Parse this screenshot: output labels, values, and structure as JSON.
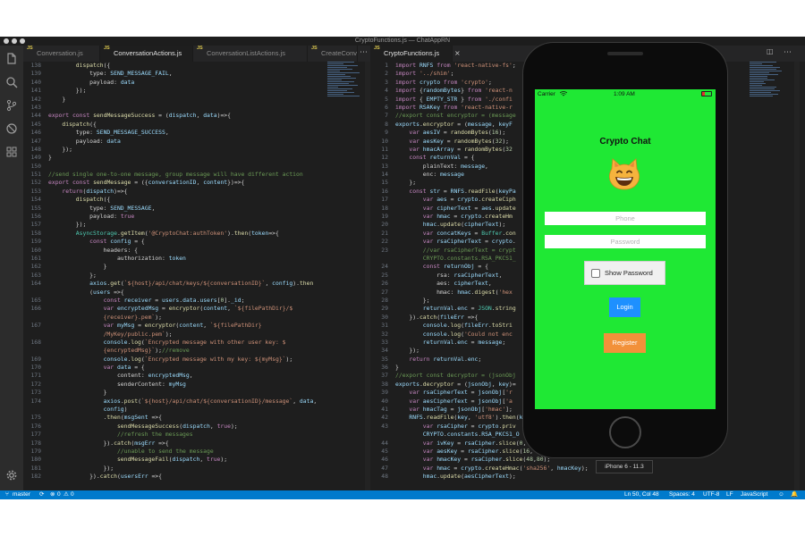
{
  "window": {
    "title": "CryptoFunctions.js — ChatAppRN"
  },
  "activity_icons": [
    "files-icon",
    "search-icon",
    "source-control-icon",
    "debug-icon",
    "extensions-icon",
    "settings-gear-icon"
  ],
  "tabs_left": [
    {
      "label": "Conversation.js"
    },
    {
      "label": "ConversationActions.js"
    },
    {
      "label": "ConversationListActions.js"
    },
    {
      "label": "CreateConv"
    }
  ],
  "tabs_right": [
    {
      "label": "CryptoFunctions.js"
    }
  ],
  "editor_left": {
    "lines": [
      {
        "no": "138",
        "html": "        <span class=\"f\">dispatch</span>({"
      },
      {
        "no": "139",
        "html": "            type: <span class=\"v\">SEND_MESSAGE_FAIL</span>,"
      },
      {
        "no": "140",
        "html": "            payload: <span class=\"v\">data</span>"
      },
      {
        "no": "141",
        "html": "        });"
      },
      {
        "no": "142",
        "html": "    }"
      },
      {
        "no": "143",
        "html": ""
      },
      {
        "no": "144",
        "html": "<span class=\"k\">export</span> <span class=\"k\">const</span> <span class=\"f\">sendMessageSuccess</span> = (<span class=\"v\">dispatch</span>, <span class=\"v\">data</span>)=>{"
      },
      {
        "no": "145",
        "html": "    <span class=\"f\">dispatch</span>({"
      },
      {
        "no": "146",
        "html": "        type: <span class=\"v\">SEND_MESSAGE_SUCCESS</span>,"
      },
      {
        "no": "147",
        "html": "        payload: <span class=\"v\">data</span>"
      },
      {
        "no": "148",
        "html": "    });"
      },
      {
        "no": "149",
        "html": "}"
      },
      {
        "no": "150",
        "html": ""
      },
      {
        "no": "151",
        "html": "<span class=\"c\">//send single one-to-one message, group message will have different action</span>"
      },
      {
        "no": "152",
        "html": "<span class=\"k\">export</span> <span class=\"k\">const</span> <span class=\"f\">sendMessage</span> = ({<span class=\"v\">conversationID</span>, <span class=\"v\">content</span>})=>{"
      },
      {
        "no": "153",
        "html": "    <span class=\"k\">return</span>(<span class=\"v\">dispatch</span>)=>{"
      },
      {
        "no": "154",
        "html": "        <span class=\"f\">dispatch</span>({"
      },
      {
        "no": "155",
        "html": "            type: <span class=\"v\">SEND_MESSAGE</span>,"
      },
      {
        "no": "156",
        "html": "            payload: <span class=\"k\">true</span>"
      },
      {
        "no": "157",
        "html": "        });"
      },
      {
        "no": "158",
        "html": "        <span class=\"t\">AsyncStorage</span>.<span class=\"f\">getItem</span>(<span class=\"s\">'@CryptoChat:authToken'</span>).<span class=\"f\">then</span>(<span class=\"v\">token</span>=>{"
      },
      {
        "no": "159",
        "html": "            <span class=\"k\">const</span> <span class=\"v\">config</span> = {"
      },
      {
        "no": "160",
        "html": "                headers: {"
      },
      {
        "no": "161",
        "html": "                    authorization: <span class=\"v\">token</span>"
      },
      {
        "no": "162",
        "html": "                }"
      },
      {
        "no": "163",
        "html": "            };"
      },
      {
        "no": "164",
        "html": "            <span class=\"v\">axios</span>.<span class=\"f\">get</span>(<span class=\"s\">`${host}/api/chat/keys/${conversationID}`</span>, <span class=\"v\">config</span>).<span class=\"f\">then</span>"
      },
      {
        "no": "",
        "html": "            (<span class=\"v\">users</span> =>{"
      },
      {
        "no": "165",
        "html": "                <span class=\"k\">const</span> <span class=\"v\">receiver</span> = <span class=\"v\">users</span>.<span class=\"v\">data</span>.<span class=\"v\">users</span>[<span class=\"n\">0</span>].<span class=\"v\">_id</span>;"
      },
      {
        "no": "166",
        "html": "                <span class=\"k\">var</span> <span class=\"v\">encryptedMsg</span> = <span class=\"f\">encryptor</span>(<span class=\"v\">content</span>, <span class=\"s\">`${filePathDir}/$</span>"
      },
      {
        "no": "",
        "html": "                <span class=\"s\">{receiver}.pem`</span>);"
      },
      {
        "no": "167",
        "html": "                <span class=\"k\">var</span> <span class=\"v\">myMsg</span> = <span class=\"f\">encryptor</span>(<span class=\"v\">content</span>, <span class=\"s\">`${filePathDir}</span>"
      },
      {
        "no": "",
        "html": "                <span class=\"s\">/MyKey/public.pem`</span>);"
      },
      {
        "no": "168",
        "html": "                <span class=\"v\">console</span>.<span class=\"f\">log</span>(<span class=\"s\">`Encrypted message with other user key: $</span>"
      },
      {
        "no": "",
        "html": "                <span class=\"s\">{encryptedMsg}`</span>);<span class=\"c\">//remove</span>"
      },
      {
        "no": "169",
        "html": "                <span class=\"v\">console</span>.<span class=\"f\">log</span>(<span class=\"s\">`Encrypted message with my key: ${myMsg}`</span>);"
      },
      {
        "no": "170",
        "html": "                <span class=\"k\">var</span> <span class=\"v\">data</span> = {"
      },
      {
        "no": "171",
        "html": "                    content: <span class=\"v\">encryptedMsg</span>,"
      },
      {
        "no": "172",
        "html": "                    senderContent: <span class=\"v\">myMsg</span>"
      },
      {
        "no": "173",
        "html": "                }"
      },
      {
        "no": "174",
        "html": "                <span class=\"v\">axios</span>.<span class=\"f\">post</span>(<span class=\"s\">`${host}/api/chat/${conversationID}/message`</span>, <span class=\"v\">data</span>,"
      },
      {
        "no": "",
        "html": "                <span class=\"v\">config</span>)"
      },
      {
        "no": "175",
        "html": "                .<span class=\"f\">then</span>(<span class=\"v\">msgSent</span> =>{"
      },
      {
        "no": "176",
        "html": "                    <span class=\"f\">sendMessageSuccess</span>(<span class=\"v\">dispatch</span>, <span class=\"k\">true</span>);"
      },
      {
        "no": "177",
        "html": "                    <span class=\"c\">//refresh the messages</span>"
      },
      {
        "no": "178",
        "html": "                }).<span class=\"f\">catch</span>(<span class=\"v\">msgErr</span> =>{"
      },
      {
        "no": "179",
        "html": "                    <span class=\"c\">//unable to send the message</span>"
      },
      {
        "no": "180",
        "html": "                    <span class=\"f\">sendMessageFail</span>(<span class=\"v\">dispatch</span>, <span class=\"k\">true</span>);"
      },
      {
        "no": "181",
        "html": "                });"
      },
      {
        "no": "182",
        "html": "            }).<span class=\"f\">catch</span>(<span class=\"v\">usersErr</span> =>{"
      }
    ]
  },
  "editor_right": {
    "lines": [
      {
        "no": "1",
        "html": "<span class=\"k\">import</span> <span class=\"v\">RNFS</span> <span class=\"k\">from</span> <span class=\"s\">'react-native-fs'</span>;"
      },
      {
        "no": "2",
        "html": "<span class=\"k\">import</span> <span class=\"s\">'../shim'</span>;"
      },
      {
        "no": "3",
        "html": "<span class=\"k\">import</span> <span class=\"v\">crypto</span> <span class=\"k\">from</span> <span class=\"s\">'crypto'</span>;"
      },
      {
        "no": "4",
        "html": "<span class=\"k\">import</span> {<span class=\"v\">randomBytes</span>} <span class=\"k\">from</span> <span class=\"s\">'react-n</span>"
      },
      {
        "no": "5",
        "html": "<span class=\"k\">import</span> { <span class=\"v\">EMPTY_STR</span> } <span class=\"k\">from</span> <span class=\"s\">'./confi</span>"
      },
      {
        "no": "6",
        "html": "<span class=\"k\">import</span> <span class=\"v\">RSAKey</span> <span class=\"k\">from</span> <span class=\"s\">'react-native-r</span>"
      },
      {
        "no": "7",
        "html": "<span class=\"c\">//export const encryptor = (message</span>"
      },
      {
        "no": "8",
        "html": "<span class=\"v\">exports</span>.<span class=\"f\">encryptor</span> = (<span class=\"v\">message</span>, <span class=\"v\">keyF</span>"
      },
      {
        "no": "9",
        "html": "    <span class=\"k\">var</span> <span class=\"v\">aesIV</span> = <span class=\"f\">randomBytes</span>(<span class=\"n\">16</span>);"
      },
      {
        "no": "10",
        "html": "    <span class=\"k\">var</span> <span class=\"v\">aesKey</span> = <span class=\"f\">randomBytes</span>(<span class=\"n\">32</span>);"
      },
      {
        "no": "11",
        "html": "    <span class=\"k\">var</span> <span class=\"v\">hmacArray</span> = <span class=\"f\">randomBytes</span>(<span class=\"n\">32</span>"
      },
      {
        "no": "12",
        "html": "    <span class=\"k\">const</span> <span class=\"v\">returnVal</span> = {"
      },
      {
        "no": "13",
        "html": "        plainText: <span class=\"v\">message</span>,"
      },
      {
        "no": "14",
        "html": "        enc: <span class=\"v\">message</span>"
      },
      {
        "no": "15",
        "html": "    };"
      },
      {
        "no": "16",
        "html": "    <span class=\"k\">const</span> <span class=\"v\">str</span> = <span class=\"v\">RNFS</span>.<span class=\"f\">readFile</span>(<span class=\"v\">keyPa</span>"
      },
      {
        "no": "17",
        "html": "        <span class=\"k\">var</span> <span class=\"v\">aes</span> = <span class=\"v\">crypto</span>.<span class=\"f\">createCiph</span>"
      },
      {
        "no": "18",
        "html": "        <span class=\"k\">var</span> <span class=\"v\">cipherText</span> = <span class=\"v\">aes</span>.<span class=\"f\">update</span>"
      },
      {
        "no": "19",
        "html": "        <span class=\"k\">var</span> <span class=\"v\">hmac</span> = <span class=\"v\">crypto</span>.<span class=\"f\">createHm</span>"
      },
      {
        "no": "20",
        "html": "        <span class=\"v\">hmac</span>.<span class=\"f\">update</span>(<span class=\"v\">cipherText</span>);"
      },
      {
        "no": "21",
        "html": "        <span class=\"k\">var</span> <span class=\"v\">concatKeys</span> = <span class=\"t\">Buffer</span>.<span class=\"f\">con</span>"
      },
      {
        "no": "22",
        "html": "        <span class=\"k\">var</span> <span class=\"v\">rsaCipherText</span> = <span class=\"v\">crypto</span>."
      },
      {
        "no": "23",
        "html": "        <span class=\"c\">//var rsaCipherText = crypt</span>"
      },
      {
        "no": "",
        "html": "        <span class=\"c\">CRYPTO.constants.RSA_PKCS1_</span>"
      },
      {
        "no": "24",
        "html": "        <span class=\"k\">const</span> <span class=\"v\">returnObj</span> = {"
      },
      {
        "no": "25",
        "html": "            rsa: <span class=\"v\">rsaCipherText</span>,"
      },
      {
        "no": "26",
        "html": "            aes: <span class=\"v\">cipherText</span>,"
      },
      {
        "no": "27",
        "html": "            hmac: <span class=\"v\">hmac</span>.<span class=\"f\">digest</span>(<span class=\"s\">'hex</span>"
      },
      {
        "no": "28",
        "html": "        };"
      },
      {
        "no": "29",
        "html": "        <span class=\"v\">returnVal</span>.<span class=\"v\">enc</span> = <span class=\"t\">JSON</span>.<span class=\"f\">string</span>"
      },
      {
        "no": "30",
        "html": "    }).<span class=\"f\">catch</span>(<span class=\"v\">fileErr</span> =>{"
      },
      {
        "no": "31",
        "html": "        <span class=\"v\">console</span>.<span class=\"f\">log</span>(<span class=\"v\">fileErr</span>.<span class=\"f\">toStri</span>"
      },
      {
        "no": "32",
        "html": "        <span class=\"v\">console</span>.<span class=\"f\">log</span>(<span class=\"s\">'Could not enc</span>"
      },
      {
        "no": "33",
        "html": "        <span class=\"v\">returnVal</span>.<span class=\"v\">enc</span> = <span class=\"v\">message</span>;"
      },
      {
        "no": "34",
        "html": "    });"
      },
      {
        "no": "35",
        "html": "    <span class=\"k\">return</span> <span class=\"v\">returnVal</span>.<span class=\"v\">enc</span>;"
      },
      {
        "no": "36",
        "html": "}"
      },
      {
        "no": "37",
        "html": "<span class=\"c\">//export const decryptor = (jsonObj</span>"
      },
      {
        "no": "38",
        "html": "<span class=\"v\">exports</span>.<span class=\"f\">decryptor</span> = (<span class=\"v\">jsonObj</span>, <span class=\"v\">key</span>)="
      },
      {
        "no": "39",
        "html": "    <span class=\"k\">var</span> <span class=\"v\">rsaCipherText</span> = <span class=\"v\">jsonObj</span>[<span class=\"s\">'r</span>"
      },
      {
        "no": "40",
        "html": "    <span class=\"k\">var</span> <span class=\"v\">aesCipherText</span> = <span class=\"v\">jsonObj</span>[<span class=\"s\">'a</span>"
      },
      {
        "no": "41",
        "html": "    <span class=\"k\">var</span> <span class=\"v\">hmacTag</span> = <span class=\"v\">jsonObj</span>[<span class=\"s\">'hmac'</span>];"
      },
      {
        "no": "42",
        "html": "    <span class=\"v\">RNFS</span>.<span class=\"f\">readFile</span>(<span class=\"v\">key</span>, <span class=\"s\">'utf8'</span>).<span class=\"f\">then</span>(<span class=\"v\">k</span>"
      },
      {
        "no": "43",
        "html": "        <span class=\"k\">var</span> <span class=\"v\">rsaCipher</span> = <span class=\"v\">crypto</span>.<span class=\"f\">priv</span>"
      },
      {
        "no": "",
        "html": "        <span class=\"v\">CRYPTO</span>.<span class=\"v\">constants</span>.<span class=\"v\">RSA_PKCS1_O</span>"
      },
      {
        "no": "44",
        "html": "        <span class=\"k\">var</span> <span class=\"v\">ivKey</span> = <span class=\"v\">rsaCipher</span>.<span class=\"f\">slice</span>(<span class=\"n\">0</span>,"
      },
      {
        "no": "45",
        "html": "        <span class=\"k\">var</span> <span class=\"v\">aesKey</span> = <span class=\"v\">rsaCipher</span>.<span class=\"f\">slice</span>(<span class=\"n\">16</span>, <span class=\"n\">48</span>);"
      },
      {
        "no": "46",
        "html": "        <span class=\"k\">var</span> <span class=\"v\">hmacKey</span> = <span class=\"v\">rsaCipher</span>.<span class=\"f\">slice</span>(<span class=\"n\">48</span>,<span class=\"n\">80</span>);"
      },
      {
        "no": "47",
        "html": "        <span class=\"k\">var</span> <span class=\"v\">hmac</span> = <span class=\"v\">crypto</span>.<span class=\"f\">createHmac</span>(<span class=\"s\">'sha256'</span>, <span class=\"v\">hmacKey</span>);"
      },
      {
        "no": "48",
        "html": "        <span class=\"v\">hmac</span>.<span class=\"f\">update</span>(<span class=\"v\">aesCipherText</span>);"
      }
    ]
  },
  "simulator": {
    "carrier": "Carrier",
    "time": "1:09 AM",
    "app_title": "Crypto Chat",
    "phone_placeholder": "Phone",
    "password_placeholder": "Password",
    "show_password_label": "Show Password",
    "show_password_checked": false,
    "login_label": "Login",
    "register_label": "Register",
    "device_label": "iPhone 6 - 11.3",
    "colors": {
      "screen": "#1fe834",
      "login": "#1e90ff",
      "register": "#f2913a"
    }
  },
  "status": {
    "branch": "master",
    "errors": "0",
    "warnings": "0",
    "position": "Ln 50, Col 48",
    "spaces": "Spaces: 4",
    "encoding": "UTF-8",
    "eol": "LF",
    "language": "JavaScript"
  }
}
